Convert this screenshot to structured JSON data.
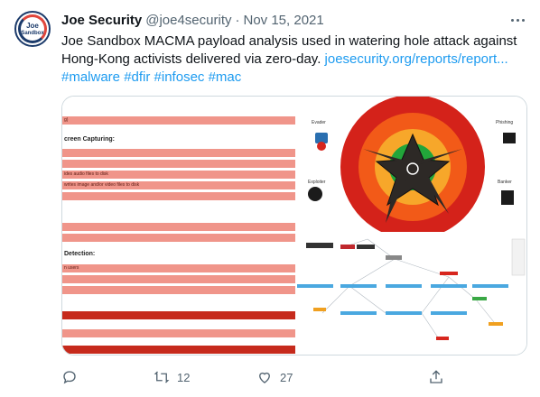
{
  "tweet": {
    "author_name": "Joe Security",
    "handle": "@joe4security",
    "separator": "·",
    "date": "Nov 15, 2021",
    "avatar_text_line1": "Joe",
    "avatar_text_line2": "Sandbox",
    "text_main": "Joe Sandbox MACMA payload analysis used in watering hole attack against Hong-Kong activists delivered via zero-day. ",
    "link_url": "joesecurity.org/reports/report...",
    "hashtags": "#malware #dfir #infosec #mac"
  },
  "media": {
    "report_rows": {
      "top_label": "g)",
      "section1": "creen Capturing:",
      "row_audio": "ides audio files to disk",
      "row_image": "writes image and/or video files to disk",
      "section2": "Detection:",
      "row_users": "n users"
    },
    "diagram": {
      "label_evader": "Evader",
      "label_phishing": "Phishing",
      "label_exploiter": "Exploiter",
      "label_banker": "Banker"
    }
  },
  "actions": {
    "reply_count": "",
    "retweet_count": "12",
    "like_count": "27",
    "share_count": ""
  },
  "icons": {
    "reply": "reply-icon",
    "retweet": "retweet-icon",
    "like": "heart-icon",
    "share": "share-icon",
    "more": "more-icon"
  }
}
